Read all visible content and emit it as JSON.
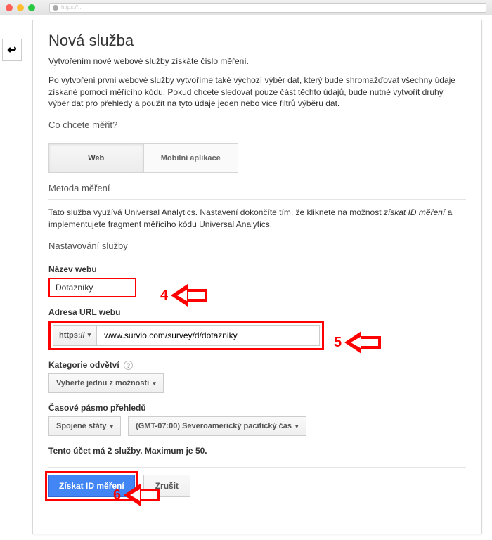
{
  "browser": {
    "url_placeholder": "https://..."
  },
  "nav": {
    "back_glyph": "↩"
  },
  "page": {
    "title": "Nová služba",
    "lead": "Vytvořením nové webové služby získáte číslo měření.",
    "description": "Po vytvoření první webové služby vytvoříme také výchozí výběr dat, který bude shromažďovat všechny údaje získané pomocí měřicího kódu. Pokud chcete sledovat pouze část těchto údajů, bude nutné vytvořit druhý výběr dat pro přehledy a použít na tyto údaje jeden nebo více filtrů výběru dat."
  },
  "measure": {
    "heading": "Co chcete měřit?",
    "options": {
      "web": "Web",
      "mobile": "Mobilní aplikace"
    }
  },
  "method": {
    "heading": "Metoda měření",
    "text_prefix": "Tato služba využívá Universal Analytics. Nastavení dokončíte tím, že kliknete na možnost ",
    "emphasis": "získat ID měření",
    "text_suffix": " a implementujete fragment měřicího kódu Universal Analytics."
  },
  "setup": {
    "heading": "Nastavování služby",
    "site_name_label": "Název webu",
    "site_name_value": "Dotazníky",
    "site_url_label": "Adresa URL webu",
    "protocol": "https://",
    "site_url_value": "www.survio.com/survey/d/dotazniky",
    "category_label": "Kategorie odvětví",
    "category_value": "Vyberte jednu z možností",
    "timezone_label": "Časové pásmo přehledů",
    "tz_country": "Spojené státy",
    "tz_value": "(GMT-07:00) Severoamerický pacifický čas"
  },
  "account_note": "Tento účet má 2 služby. Maximum je 50.",
  "buttons": {
    "primary": "Získat ID měření",
    "cancel": "Zrušit"
  },
  "annotations": {
    "a4": "4",
    "a5": "5",
    "a6": "6"
  },
  "glyphs": {
    "caret": "▾",
    "help": "?"
  }
}
